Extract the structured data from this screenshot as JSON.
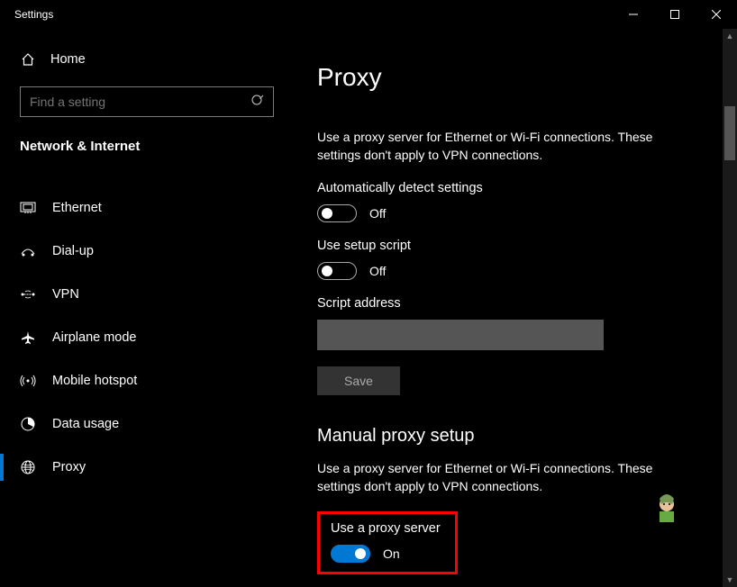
{
  "window": {
    "title": "Settings"
  },
  "sidebar": {
    "home_label": "Home",
    "search_placeholder": "Find a setting",
    "category": "Network & Internet",
    "items": [
      {
        "label": "Ethernet"
      },
      {
        "label": "Dial-up"
      },
      {
        "label": "VPN"
      },
      {
        "label": "Airplane mode"
      },
      {
        "label": "Mobile hotspot"
      },
      {
        "label": "Data usage"
      },
      {
        "label": "Proxy"
      }
    ]
  },
  "main": {
    "title": "Proxy",
    "desc1": "Use a proxy server for Ethernet or Wi-Fi connections. These settings don't apply to VPN connections.",
    "auto_detect": {
      "label": "Automatically detect settings",
      "state": "Off"
    },
    "setup_script": {
      "label": "Use setup script",
      "state": "Off"
    },
    "script_address_label": "Script address",
    "script_address_value": "",
    "save_label": "Save",
    "manual_heading": "Manual proxy setup",
    "desc2": "Use a proxy server for Ethernet or Wi-Fi connections. These settings don't apply to VPN connections.",
    "use_proxy": {
      "label": "Use a proxy server",
      "state": "On"
    }
  }
}
